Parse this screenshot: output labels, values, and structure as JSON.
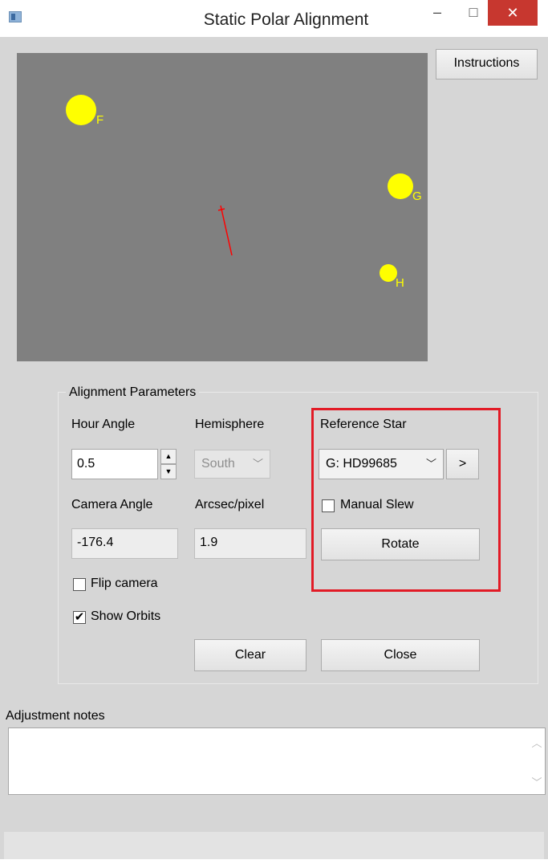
{
  "window": {
    "title": "Static Polar Alignment",
    "minimize_glyph": "–",
    "maximize_glyph": "□",
    "close_glyph": "✕"
  },
  "canvas": {
    "background": "#808080",
    "star_color": "#ffff00",
    "orbit_line_color": "#ff0000",
    "stars": [
      {
        "label": "F"
      },
      {
        "label": "G"
      },
      {
        "label": "H"
      }
    ]
  },
  "instructions_button": "Instructions",
  "alignment": {
    "group_title": "Alignment Parameters",
    "hour_angle_label": "Hour Angle",
    "hour_angle_value": "0.5",
    "hemisphere_label": "Hemisphere",
    "hemisphere_value": "South",
    "camera_angle_label": "Camera Angle",
    "camera_angle_value": "-176.4",
    "arcsec_label": "Arcsec/pixel",
    "arcsec_value": "1.9",
    "flip_camera_label": "Flip camera",
    "flip_camera_checked": false,
    "show_orbits_label": "Show Orbits",
    "show_orbits_checked": true,
    "clear_button": "Clear",
    "close_button": "Close"
  },
  "reference": {
    "label": "Reference Star",
    "star_value": "G: HD99685",
    "next_button": ">",
    "manual_slew_label": "Manual Slew",
    "manual_slew_checked": false,
    "rotate_button": "Rotate",
    "highlight_color": "#e21b26"
  },
  "notes": {
    "label": "Adjustment notes",
    "value": ""
  }
}
